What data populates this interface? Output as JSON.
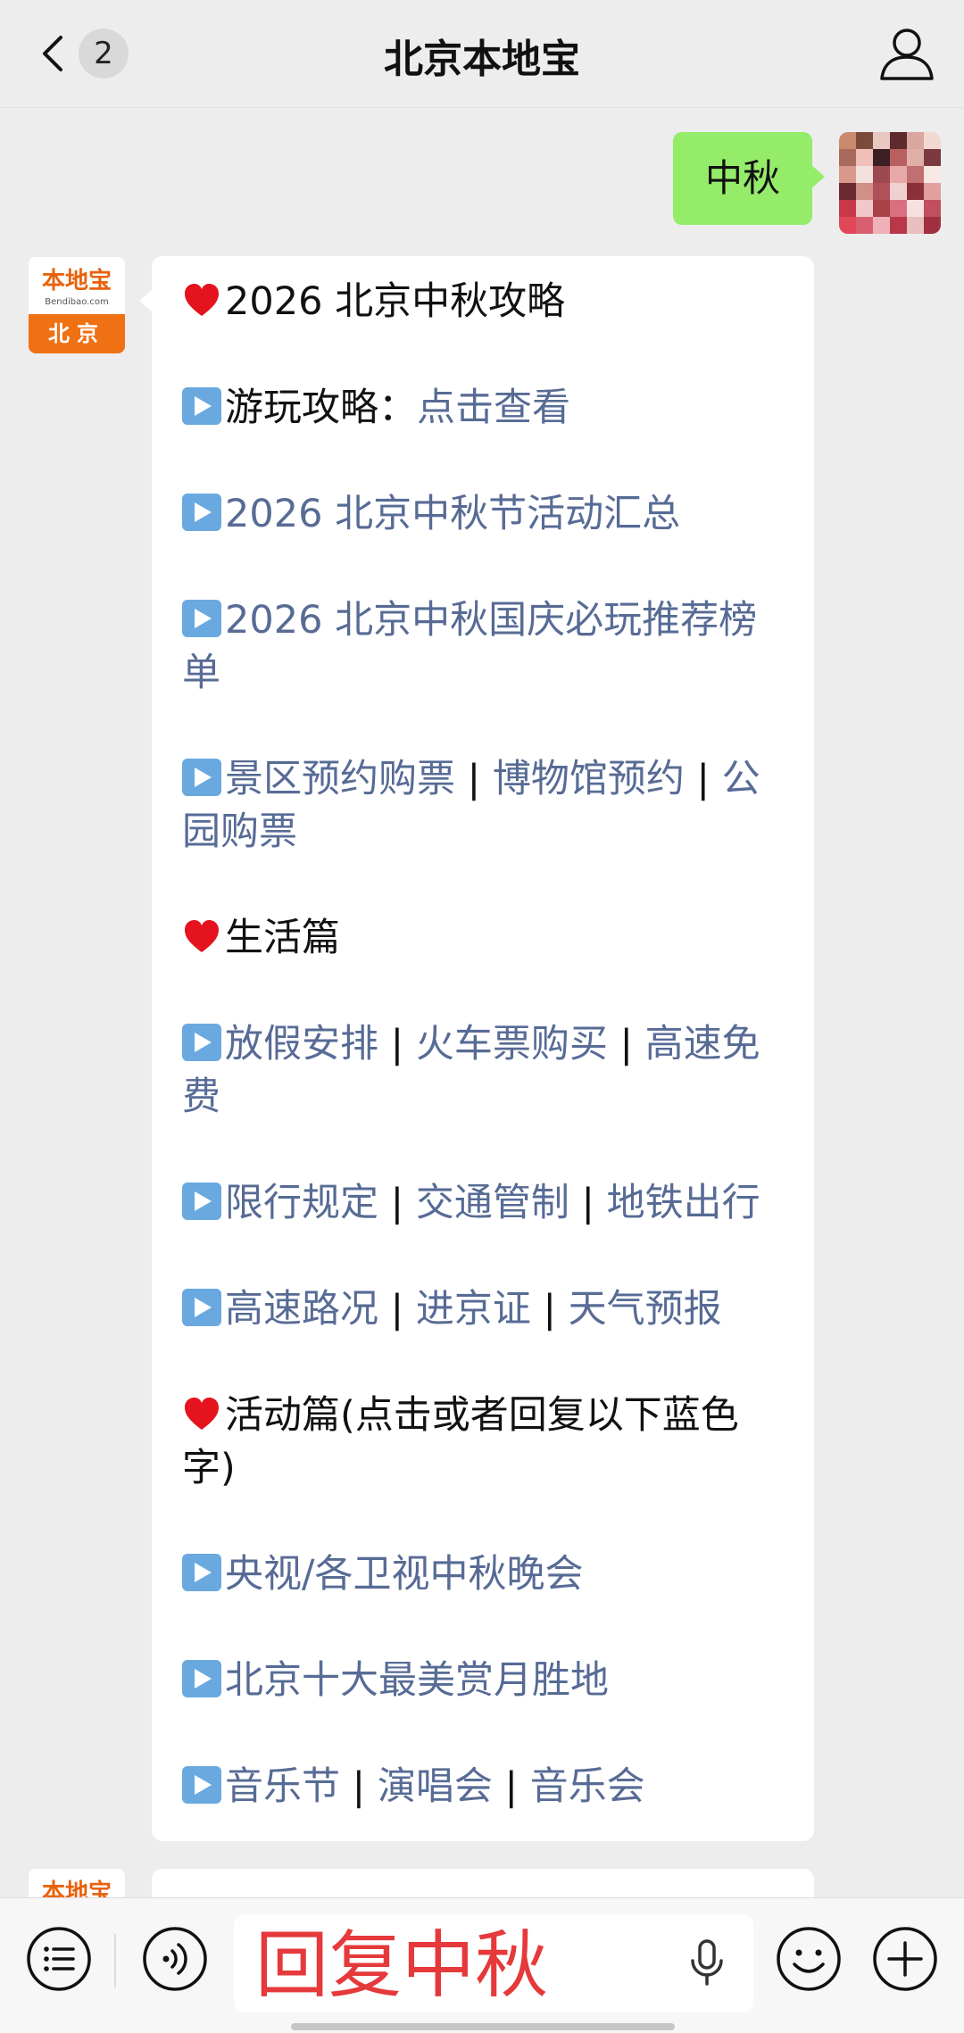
{
  "header": {
    "title": "北京本地宝",
    "unread_count": "2",
    "back_icon": "chevron-left-icon",
    "profile_icon": "person-icon"
  },
  "messages": {
    "sent": {
      "text": "中秋"
    },
    "bot_avatar": {
      "logo_text": "本地宝",
      "logo_subtext": "Bendibao.com",
      "city": "北京"
    },
    "reply": {
      "sections": [
        {
          "type": "heading",
          "icon": "heart-icon",
          "text": "2026 北京中秋攻略"
        },
        {
          "type": "item",
          "icon": "play-icon",
          "prefix": "游玩攻略：",
          "links": [
            "点击查看"
          ]
        },
        {
          "type": "item",
          "icon": "play-icon",
          "links": [
            "2026 北京中秋节活动汇总"
          ]
        },
        {
          "type": "item",
          "icon": "play-icon",
          "links": [
            "2026 北京中秋国庆必玩推荐榜单"
          ]
        },
        {
          "type": "item",
          "icon": "play-icon",
          "links": [
            "景区预约购票",
            "博物馆预约",
            "公园购票"
          ]
        },
        {
          "type": "heading",
          "icon": "heart-icon",
          "text": "生活篇"
        },
        {
          "type": "item",
          "icon": "play-icon",
          "links": [
            "放假安排",
            "火车票购买",
            "高速免费"
          ]
        },
        {
          "type": "item",
          "icon": "play-icon",
          "links": [
            "限行规定",
            "交通管制 ",
            "地铁出行"
          ]
        },
        {
          "type": "item",
          "icon": "play-icon",
          "links": [
            "高速路况",
            "进京证",
            "天气预报"
          ]
        },
        {
          "type": "heading",
          "icon": "heart-icon",
          "text": "活动篇(点击或者回复以下蓝色字)"
        },
        {
          "type": "item",
          "icon": "play-icon",
          "links": [
            "央视/各卫视中秋晚会"
          ]
        },
        {
          "type": "item",
          "icon": "play-icon",
          "links": [
            "北京十大最美赏月胜地"
          ]
        },
        {
          "type": "item",
          "icon": "play-icon",
          "links": [
            "音乐节",
            "演唱会",
            "音乐会"
          ]
        }
      ],
      "separator": " | "
    },
    "partial_avatar_text": "本地宝"
  },
  "input_bar": {
    "typed_text": "回复中秋",
    "menu_icon": "list-menu-icon",
    "voice_icon": "voice-icon",
    "mic_icon": "microphone-icon",
    "emoji_icon": "emoji-icon",
    "plus_icon": "plus-icon"
  },
  "colors": {
    "background": "#ededed",
    "sent_bubble": "#95ec69",
    "link": "#576b95",
    "typed_text": "#e5393b",
    "brand_orange": "#f07014"
  }
}
